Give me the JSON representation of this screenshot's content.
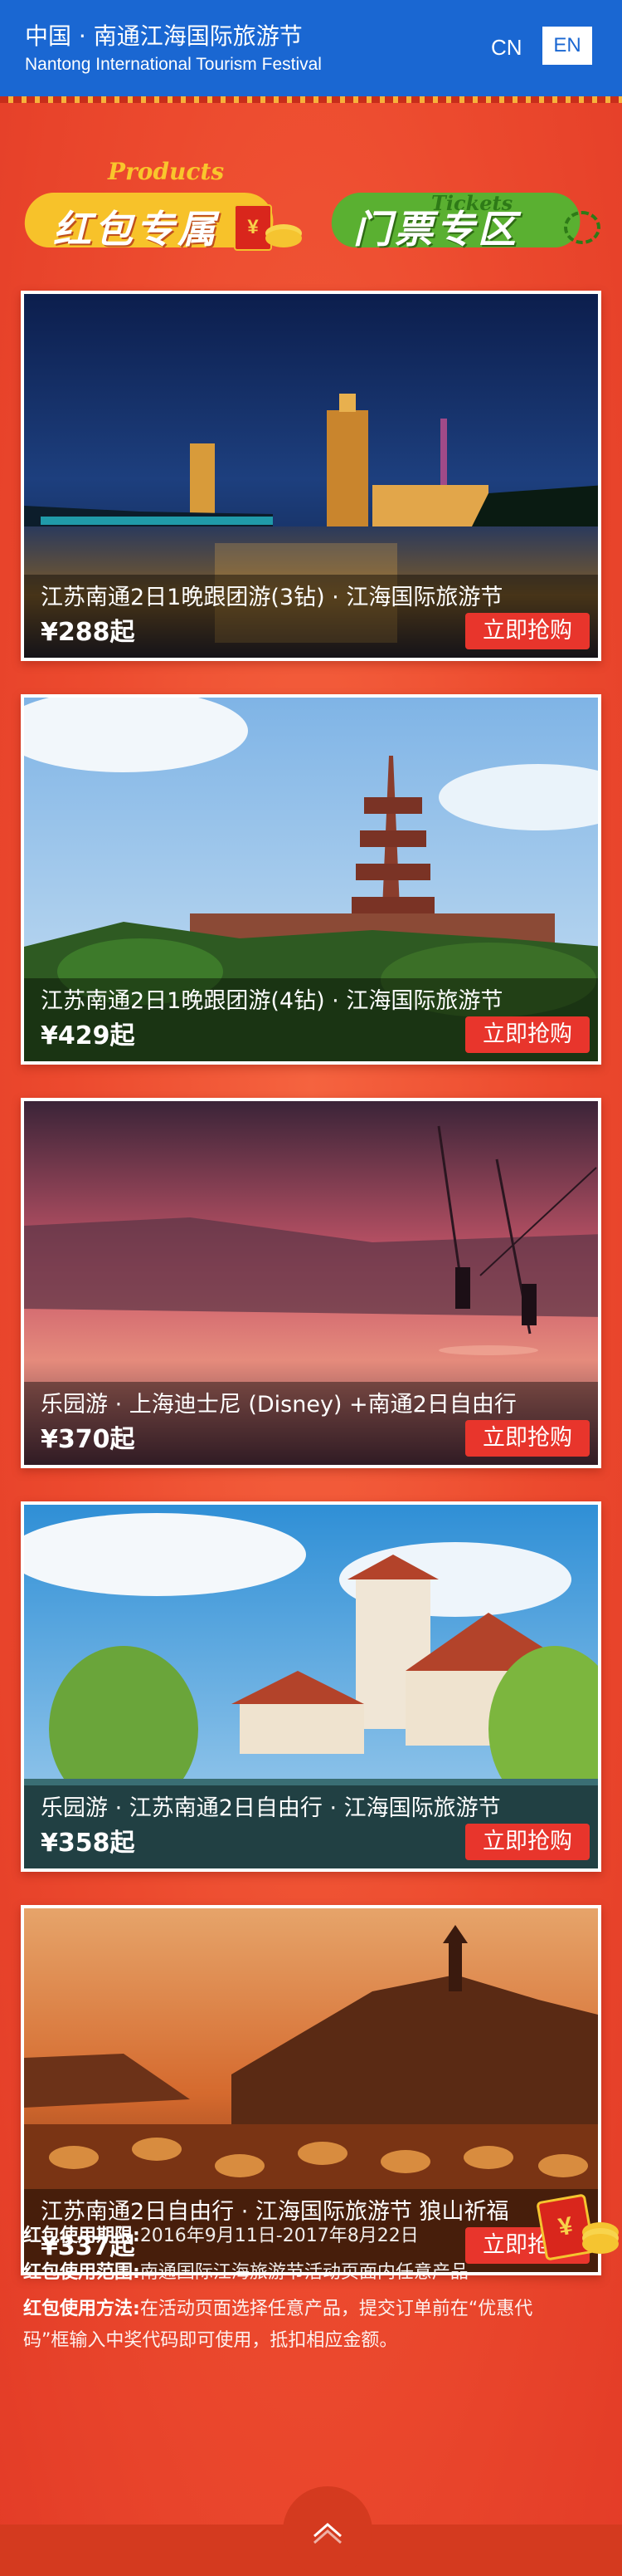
{
  "header": {
    "title": "中国 · 南通江海国际旅游节",
    "subtitle": "Nantong International Tourism Festival",
    "lang_cn": "CN",
    "lang_en": "EN"
  },
  "categories": [
    {
      "en": "Products",
      "cn": "红包专属",
      "icon": "red-packet-icon"
    },
    {
      "en": "Tickets",
      "cn": "门票专区",
      "icon": "swirl-icon"
    }
  ],
  "products": [
    {
      "name": "江苏南通2日1晚跟团游(3钻) · 江海国际旅游节",
      "price": "¥288起",
      "button": "立即抢购",
      "image": "city-night-skyline"
    },
    {
      "name": "江苏南通2日1晚跟团游(4钻) · 江海国际旅游节",
      "price": "¥429起",
      "button": "立即抢购",
      "image": "pagoda-hill"
    },
    {
      "name": "乐园游 · 上海迪士尼 (Disney) +南通2日自由行",
      "price": "¥370起",
      "button": "立即抢购",
      "image": "fishermen-sunset"
    },
    {
      "name": "乐园游 · 江苏南通2日自由行 · 江海国际旅游节",
      "price": "¥358起",
      "button": "立即抢购",
      "image": "villa-lakeside"
    },
    {
      "name": "江苏南通2日自由行 · 江海国际旅游节 狼山祈福",
      "price": "¥337起",
      "button": "立即抢购",
      "image": "langshan-reeds-sunset"
    }
  ],
  "rules": [
    {
      "label": "红包使用期限:",
      "value": "2016年9月11日-2017年8月22日"
    },
    {
      "label": "红包使用范围:",
      "value": "南通国际江海旅游节活动页面内任意产品"
    },
    {
      "label": "红包使用方法:",
      "value": "在活动页面选择任意产品，提交订单前在“优惠代码”框输入中奖代码即可使用，抵扣相应金额。"
    }
  ],
  "colors": {
    "header": "#1a67d2",
    "background": "#ec4a2e",
    "button": "#e8352c",
    "products_brush": "#f7c22a",
    "tickets_brush": "#5ab031"
  },
  "footer": {
    "back_to_top_icon": "chevron-up-icon"
  }
}
